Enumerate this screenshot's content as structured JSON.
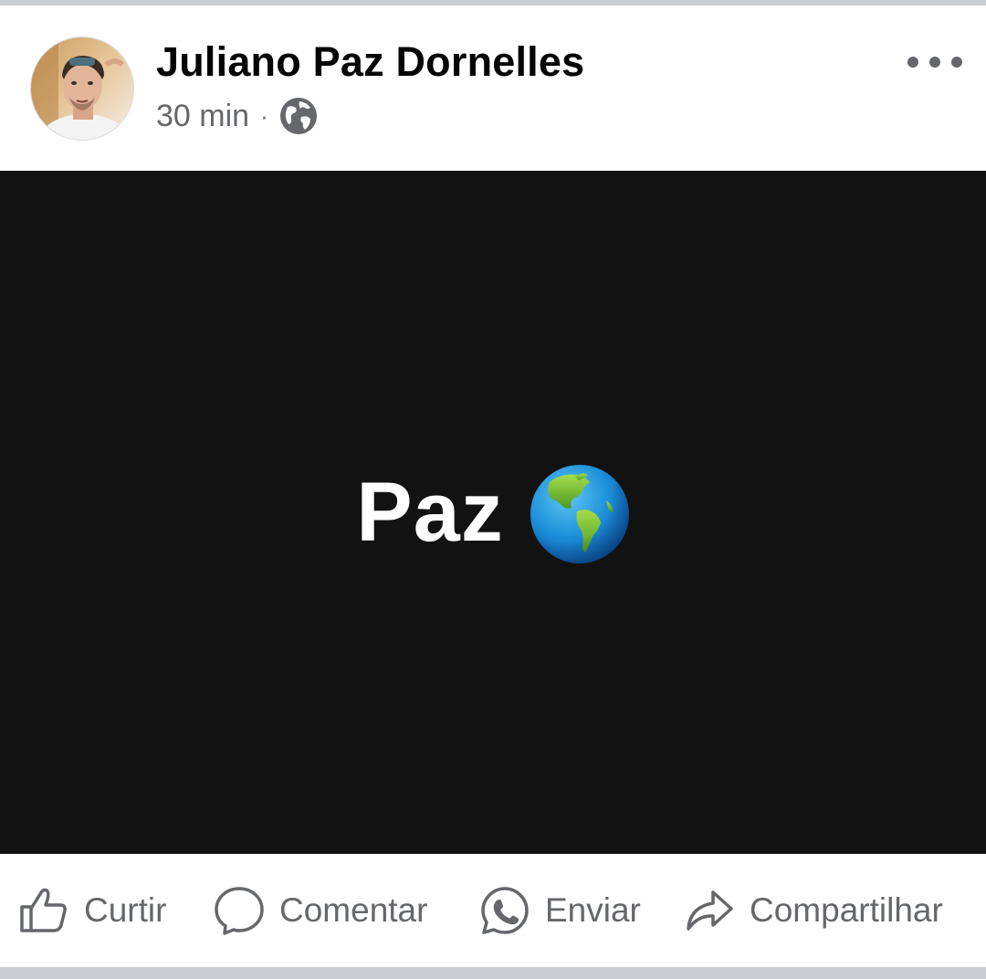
{
  "post": {
    "author_name": "Juliano Paz Dornelles",
    "timestamp": "30 min",
    "separator": "·",
    "audience_icon": "globe-icon",
    "menu_icon": "more-options-icon"
  },
  "media": {
    "text": "Paz",
    "emoji": "earth-americas-emoji",
    "background_color": "#121212"
  },
  "actions": [
    {
      "label": "Curtir",
      "icon": "thumbs-up-icon"
    },
    {
      "label": "Comentar",
      "icon": "comment-bubble-icon"
    },
    {
      "label": "Enviar",
      "icon": "whatsapp-icon"
    },
    {
      "label": "Compartilhar",
      "icon": "share-arrow-icon"
    }
  ],
  "colors": {
    "text_primary": "#050505",
    "text_secondary": "#65676b",
    "divider": "#c9ccd1"
  }
}
